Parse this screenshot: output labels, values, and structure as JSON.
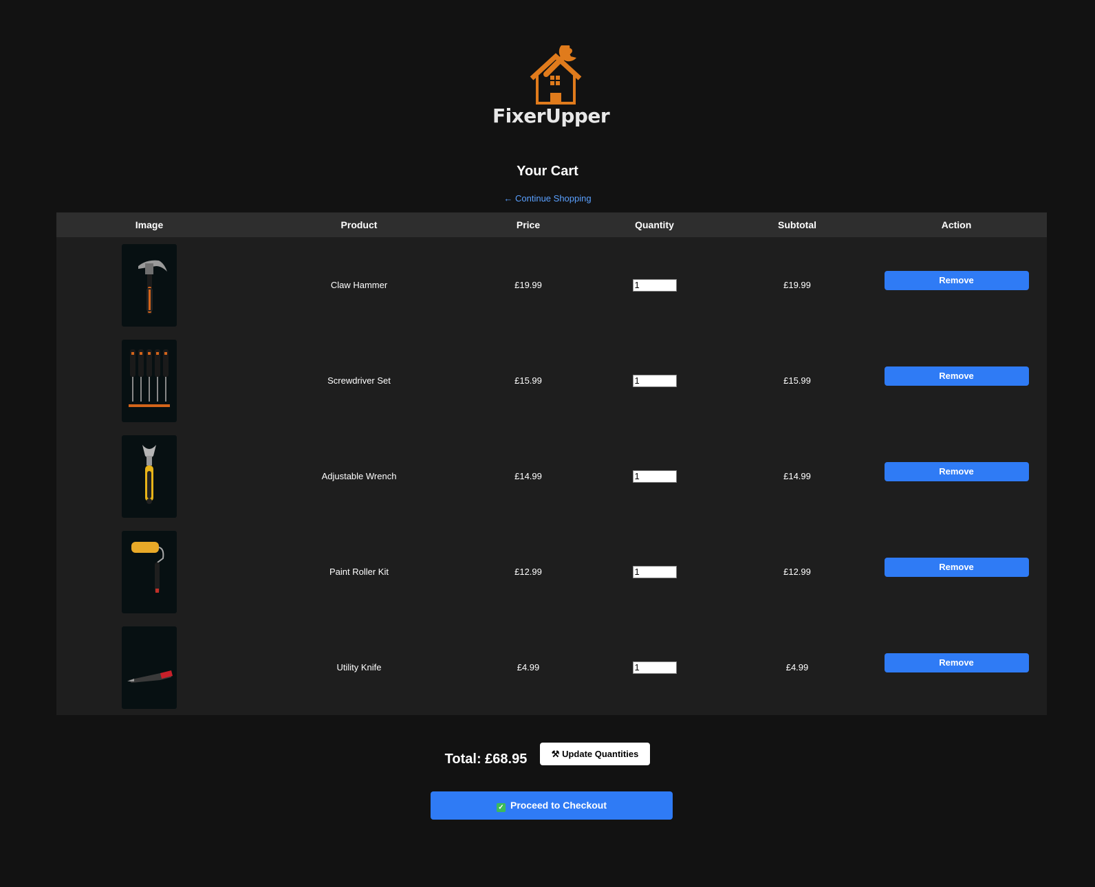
{
  "brand": {
    "name": "FixerUpper",
    "accent_color": "#e07b1c"
  },
  "page": {
    "title": "Your Cart",
    "continue_link": "← Continue Shopping"
  },
  "table": {
    "headers": [
      "Image",
      "Product",
      "Price",
      "Quantity",
      "Subtotal",
      "Action"
    ],
    "rows": [
      {
        "image_icon": "claw-hammer-image",
        "product": "Claw Hammer",
        "price": "£19.99",
        "quantity": "1",
        "subtotal": "£19.99",
        "action": "Remove"
      },
      {
        "image_icon": "screwdriver-set-image",
        "product": "Screwdriver Set",
        "price": "£15.99",
        "quantity": "1",
        "subtotal": "£15.99",
        "action": "Remove"
      },
      {
        "image_icon": "adjustable-wrench-image",
        "product": "Adjustable Wrench",
        "price": "£14.99",
        "quantity": "1",
        "subtotal": "£14.99",
        "action": "Remove"
      },
      {
        "image_icon": "paint-roller-image",
        "product": "Paint Roller Kit",
        "price": "£12.99",
        "quantity": "1",
        "subtotal": "£12.99",
        "action": "Remove"
      },
      {
        "image_icon": "utility-knife-image",
        "product": "Utility Knife",
        "price": "£4.99",
        "quantity": "1",
        "subtotal": "£4.99",
        "action": "Remove"
      }
    ]
  },
  "summary": {
    "total": "Total: £68.95",
    "update_label": "Update Quantities",
    "update_icon": "hammer-wrench-icon",
    "checkout_label": "Proceed to Checkout",
    "checkout_icon": "check-mark-icon"
  },
  "colors": {
    "button_blue": "#2f7bf5",
    "link_blue": "#5aa0ff",
    "background": "#121212"
  }
}
